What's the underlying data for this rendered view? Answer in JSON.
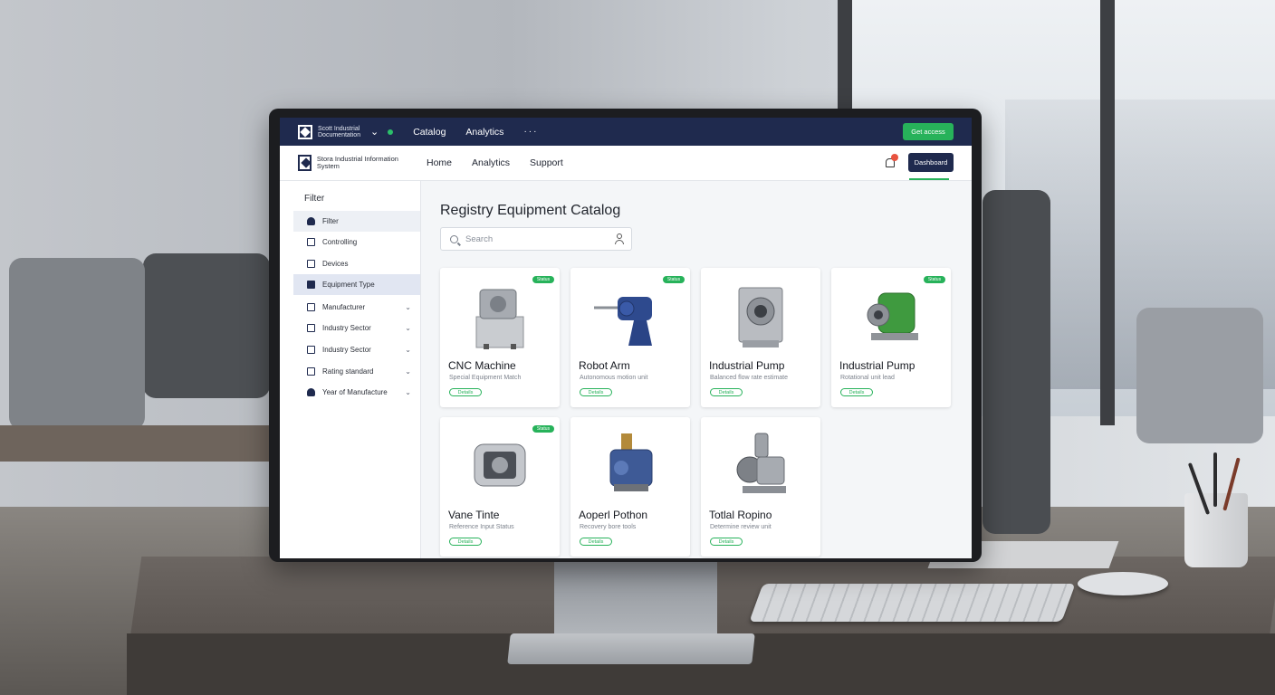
{
  "app": {
    "topbar": {
      "brand_text": "Scott Industrial Documentation",
      "nav": [
        "Catalog",
        "Analytics"
      ],
      "more": "···",
      "action_button": "Get access"
    },
    "navbar": {
      "brand_text": "Stora Industrial Information System",
      "nav": [
        "Home",
        "Analytics",
        "Support"
      ],
      "action_button": "Dashboard"
    },
    "sidebar": {
      "title": "Filter",
      "items": [
        {
          "label": "Filter",
          "icon": "user-icon"
        },
        {
          "label": "Controlling",
          "icon": "grid-icon"
        },
        {
          "label": "Devices",
          "icon": "device-icon"
        },
        {
          "label": "Equipment Type",
          "icon": "folder-icon",
          "selected": true
        },
        {
          "label": "Manufacturer",
          "icon": "factory-icon",
          "chevron": true
        },
        {
          "label": "Industry Sector",
          "icon": "building-icon",
          "chevron": true
        },
        {
          "label": "Industry Sector",
          "icon": "building-icon",
          "chevron": true
        },
        {
          "label": "Rating standard",
          "icon": "tag-icon",
          "chevron": true
        },
        {
          "label": "Year of Manufacture",
          "icon": "person-icon",
          "chevron": true
        }
      ]
    },
    "main": {
      "title": "Registry Equipment Catalog",
      "search_placeholder": "Search",
      "cards": [
        {
          "name": "CNC Machine",
          "subtitle": "Special Equipment Match",
          "badge": "Status",
          "tag": "Details",
          "image": "cnc-machine"
        },
        {
          "name": "Robot Arm",
          "subtitle": "Autonomous motion unit",
          "badge": "Status",
          "tag": "Details",
          "image": "robot-arm"
        },
        {
          "name": "Industrial Pump",
          "subtitle": "Balanced flow rate estimate",
          "badge": "",
          "tag": "Details",
          "image": "industrial-pump-gray"
        },
        {
          "name": "Industrial Pump",
          "subtitle": "Rotational unit lead",
          "badge": "Status",
          "tag": "Details",
          "image": "industrial-pump-green"
        },
        {
          "name": "Vane Tinte",
          "subtitle": "Reference Input Status",
          "badge": "Status",
          "tag": "Details",
          "image": "vane-unit"
        },
        {
          "name": "Aoperl Pothon",
          "subtitle": "Recovery bore tools",
          "badge": "",
          "tag": "Details",
          "image": "piston-unit"
        },
        {
          "name": "Totlal Ropino",
          "subtitle": "Determine review unit",
          "badge": "",
          "tag": "Details",
          "image": "rotary-unit"
        }
      ]
    }
  },
  "colors": {
    "navy": "#1f2a4e",
    "green": "#27b25a",
    "alert": "#e8533f"
  }
}
